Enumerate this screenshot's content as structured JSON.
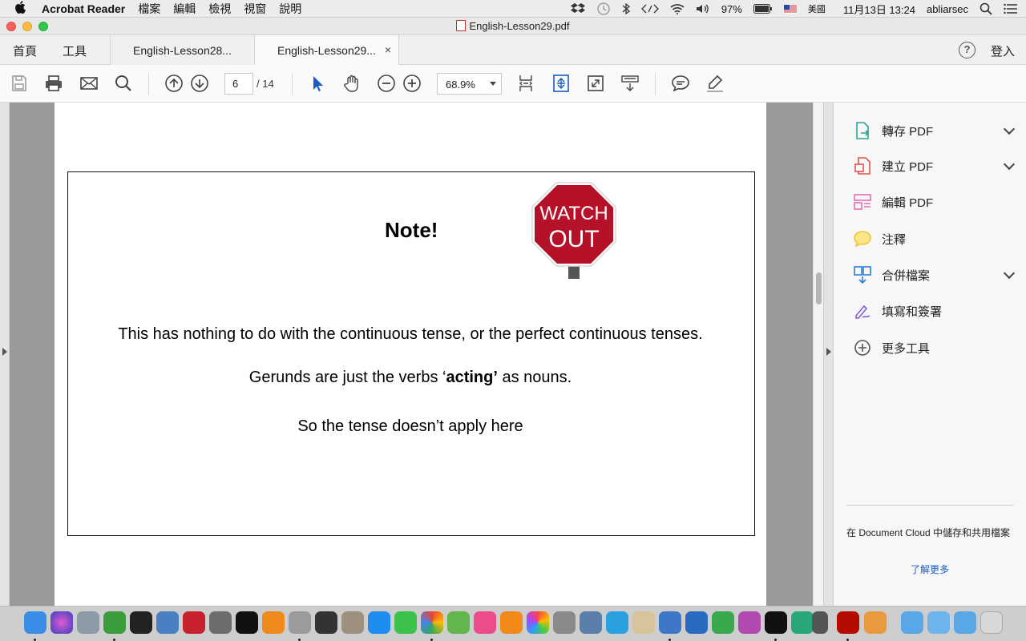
{
  "menubar": {
    "app_name": "Acrobat Reader",
    "menus": [
      "檔案",
      "編輯",
      "檢視",
      "視窗",
      "說明"
    ],
    "battery": "97%",
    "input_source": "美國",
    "datetime": "11月13日  13:24",
    "user": "abliarsec"
  },
  "window": {
    "title": "English-Lesson29.pdf"
  },
  "tabbar": {
    "home": "首頁",
    "tools": "工具",
    "tabs": [
      {
        "label": "English-Lesson28..."
      },
      {
        "label": "English-Lesson29..."
      }
    ],
    "close_glyph": "×",
    "help_glyph": "?",
    "login": "登入"
  },
  "toolbar": {
    "page_current": "6",
    "page_total": "/ 14",
    "zoom": "68.9%"
  },
  "document": {
    "note_title": "Note!",
    "sign_line1": "WATCH",
    "sign_line2": "OUT",
    "line1": "This has nothing to do with the continuous tense, or the perfect continuous tenses.",
    "line2_before": "Gerunds are just the verbs ‘",
    "line2_bold": "acting’",
    "line2_after": " as nouns.",
    "line3": "So the tense doesn’t apply here"
  },
  "right_panel": {
    "tools": [
      {
        "label": "轉存 PDF",
        "icon": "export-pdf-icon",
        "expandable": true
      },
      {
        "label": "建立 PDF",
        "icon": "create-pdf-icon",
        "expandable": true
      },
      {
        "label": "編輯 PDF",
        "icon": "edit-pdf-icon",
        "expandable": false
      },
      {
        "label": "注釋",
        "icon": "comment-icon",
        "expandable": false
      },
      {
        "label": "合併檔案",
        "icon": "combine-files-icon",
        "expandable": true
      },
      {
        "label": "填寫和簽署",
        "icon": "fill-sign-icon",
        "expandable": false
      },
      {
        "label": "更多工具",
        "icon": "more-tools-icon",
        "expandable": false
      }
    ],
    "cloud_text": "在 Document Cloud 中儲存和共用檔案",
    "learn_more": "了解更多"
  },
  "colors": {
    "accent_blue": "#1a5bc4",
    "stop_red": "#b5122a",
    "export_teal": "#2fa48f",
    "create_red": "#e0534c",
    "edit_pink": "#e46fb3",
    "comment_yellow": "#f2c534",
    "combine_blue": "#2d7fd3",
    "sign_purple": "#8a5bd6"
  }
}
